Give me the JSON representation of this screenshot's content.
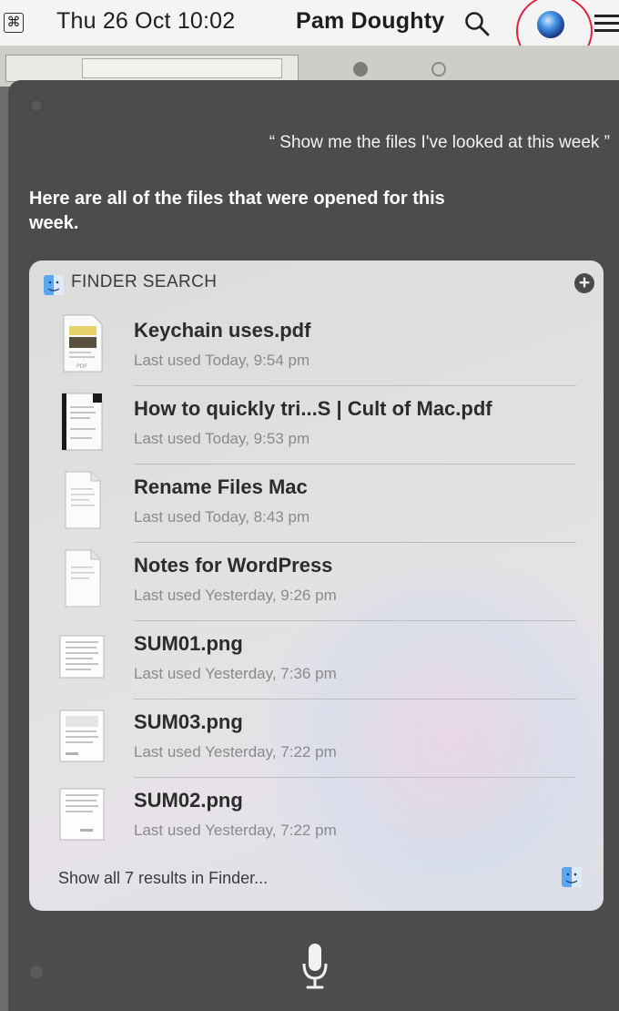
{
  "menubar": {
    "datetime": "Thu 26 Oct  10:02",
    "user": "Pam Doughty",
    "icons": [
      "command-key-icon",
      "search-icon",
      "siri-icon",
      "menu-icon"
    ]
  },
  "siri": {
    "query": "“ Show me the files I've looked at this week ”",
    "response": "Here are all of the files that were opened for this week."
  },
  "finder": {
    "title": "FINDER SEARCH",
    "results": [
      {
        "name": "Keychain uses.pdf",
        "meta": "Last used Today, 9:54 pm",
        "icon": "pdf-thumbnail-icon"
      },
      {
        "name": "How to quickly tri...S | Cult of Mac.pdf",
        "meta": "Last used Today, 9:53 pm",
        "icon": "pdf-thumbnail-icon"
      },
      {
        "name": "Rename Files Mac",
        "meta": "Last used Today, 8:43 pm",
        "icon": "document-icon"
      },
      {
        "name": "Notes for WordPress",
        "meta": "Last used Yesterday, 9:26 pm",
        "icon": "document-icon"
      },
      {
        "name": "SUM01.png",
        "meta": "Last used Yesterday, 7:36 pm",
        "icon": "image-thumbnail-icon"
      },
      {
        "name": "SUM03.png",
        "meta": "Last used Yesterday, 7:22 pm",
        "icon": "image-thumbnail-icon"
      },
      {
        "name": "SUM02.png",
        "meta": "Last used Yesterday, 7:22 pm",
        "icon": "image-thumbnail-icon"
      }
    ],
    "show_all": "Show all 7 results in Finder..."
  },
  "colors": {
    "siri_panel": "#4c4c4c",
    "highlight_ring": "#e11f43",
    "card_bg": "#e0e0e0"
  }
}
